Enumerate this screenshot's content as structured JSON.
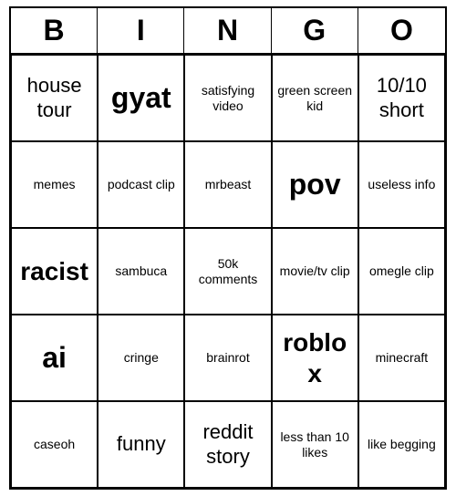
{
  "header": {
    "letters": [
      "B",
      "I",
      "N",
      "G",
      "O"
    ]
  },
  "cells": [
    {
      "text": "house tour",
      "size": "large"
    },
    {
      "text": "gyat",
      "size": "xxlarge"
    },
    {
      "text": "satisfying video",
      "size": "small"
    },
    {
      "text": "green screen kid",
      "size": "small"
    },
    {
      "text": "10/10 short",
      "size": "large"
    },
    {
      "text": "memes",
      "size": "medium"
    },
    {
      "text": "podcast clip",
      "size": "medium"
    },
    {
      "text": "mrbeast",
      "size": "medium"
    },
    {
      "text": "pov",
      "size": "xxlarge"
    },
    {
      "text": "useless info",
      "size": "medium"
    },
    {
      "text": "racist",
      "size": "xlarge"
    },
    {
      "text": "sambuca",
      "size": "small"
    },
    {
      "text": "50k comments",
      "size": "small"
    },
    {
      "text": "movie/tv clip",
      "size": "small"
    },
    {
      "text": "omegle clip",
      "size": "small"
    },
    {
      "text": "ai",
      "size": "xxlarge"
    },
    {
      "text": "cringe",
      "size": "medium"
    },
    {
      "text": "brainrot",
      "size": "medium"
    },
    {
      "text": "roblox",
      "size": "xlarge"
    },
    {
      "text": "minecraft",
      "size": "small"
    },
    {
      "text": "caseoh",
      "size": "medium"
    },
    {
      "text": "funny",
      "size": "large"
    },
    {
      "text": "reddit story",
      "size": "large"
    },
    {
      "text": "less than 10 likes",
      "size": "small"
    },
    {
      "text": "like begging",
      "size": "small"
    }
  ]
}
